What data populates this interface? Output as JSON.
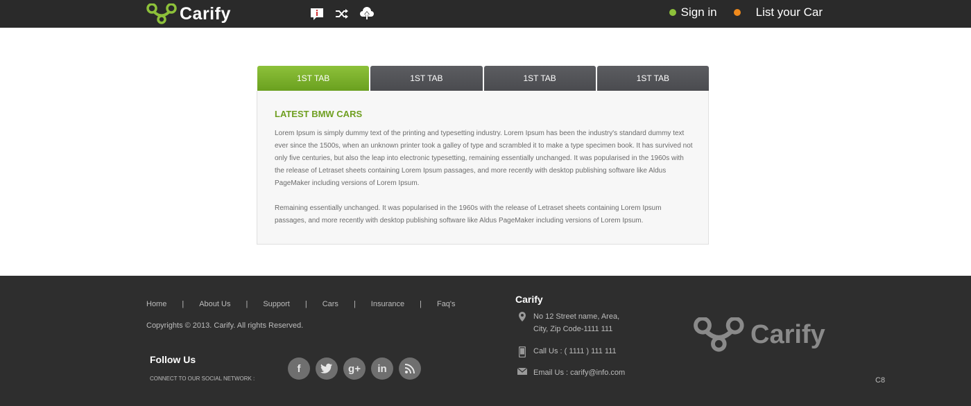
{
  "header": {
    "logo_text": "Carify",
    "sign_in": "Sign in",
    "list_car": "List your Car",
    "colors": {
      "accent_green": "#8dc13a",
      "orange": "#f08a1c",
      "header_bg": "#2a2a2a"
    }
  },
  "tabs": [
    {
      "label": "1ST TAB"
    },
    {
      "label": "1ST TAB"
    },
    {
      "label": "1ST TAB"
    },
    {
      "label": "1ST TAB"
    }
  ],
  "panel": {
    "title": "LATEST BMW CARS",
    "paragraph1": "Lorem Ipsum is simply dummy text of the printing and typesetting industry. Lorem Ipsum has been the industry's standard dummy text ever since the 1500s, when an unknown printer took a galley of type and scrambled it to make a type specimen book. It has survived not only five centuries, but also the leap into electronic typesetting, remaining essentially unchanged. It was popularised in the 1960s with the release of Letraset sheets containing Lorem Ipsum passages, and more recently with desktop publishing software like Aldus PageMaker including versions of Lorem Ipsum.",
    "paragraph2": "Remaining essentially unchanged. It was popularised in the 1960s with the release of Letraset sheets containing Lorem Ipsum passages, and more recently with desktop publishing software like Aldus PageMaker including versions of Lorem Ipsum."
  },
  "footer": {
    "nav": [
      "Home",
      "About Us",
      "Support",
      "Cars",
      "Insurance",
      "Faq's"
    ],
    "separator": "|",
    "copyright": "Copyrights © 2013. Carify. All rights Reserved.",
    "follow_title": "Follow Us",
    "follow_sub": "CONNECT TO OUR SOCIAL NETWORK :",
    "social": [
      "f",
      "t",
      "g+",
      "in",
      "rss"
    ],
    "contact_title": "Carify",
    "address_line1": "No 12 Street name,  Area,",
    "address_line2": "City, Zip Code-1111 111",
    "call": "Call Us : ( 1111 ) 111 111",
    "email": "Email Us : carify@info.com",
    "logo_text": "Carify",
    "code": "C8"
  }
}
